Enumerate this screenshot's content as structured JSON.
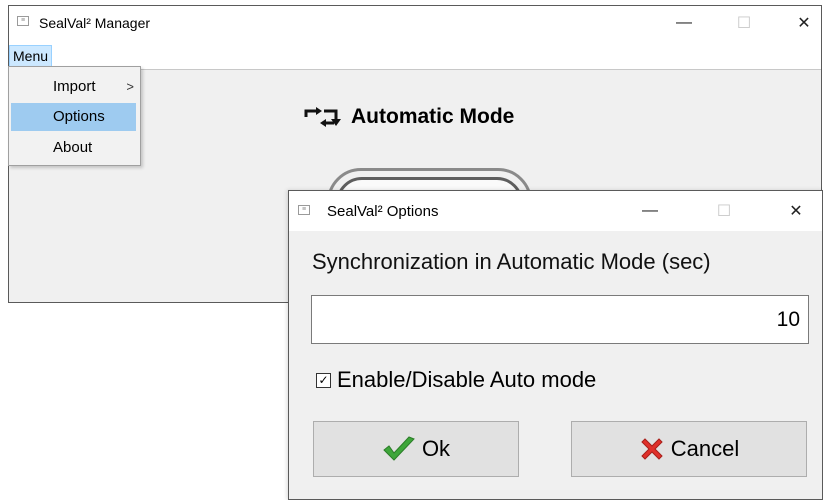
{
  "main_window": {
    "title": "SealVal² Manager",
    "controls": {
      "minimize": "—",
      "maximize": "☐",
      "close": "✕"
    },
    "menu": {
      "label": "Menu",
      "items": [
        {
          "label": "Import",
          "submenu_arrow": ">"
        },
        {
          "label": "Options"
        },
        {
          "label": "About"
        }
      ]
    },
    "heading": "Automatic Mode",
    "heading_icon": "repeat-arrows-icon"
  },
  "options_dialog": {
    "title": "SealVal² Options",
    "controls": {
      "minimize": "—",
      "maximize": "☐",
      "close": "✕"
    },
    "sync_label": "Synchronization in Automatic Mode (sec)",
    "sync_value": "10",
    "auto_mode_checkbox": {
      "label": "Enable/Disable Auto mode",
      "checked": true,
      "mark": "✓"
    },
    "ok_button": {
      "label": "Ok",
      "icon": "checkmark-icon",
      "icon_color": "#3ea63a"
    },
    "cancel_button": {
      "label": "Cancel",
      "icon": "x-mark-icon",
      "icon_color": "#e0302a"
    }
  },
  "colors": {
    "menu_highlight": "#cce8ff",
    "selected_item": "#9ecbf0",
    "window_bg": "#f0f0f0",
    "button_bg": "#e1e1e1"
  }
}
